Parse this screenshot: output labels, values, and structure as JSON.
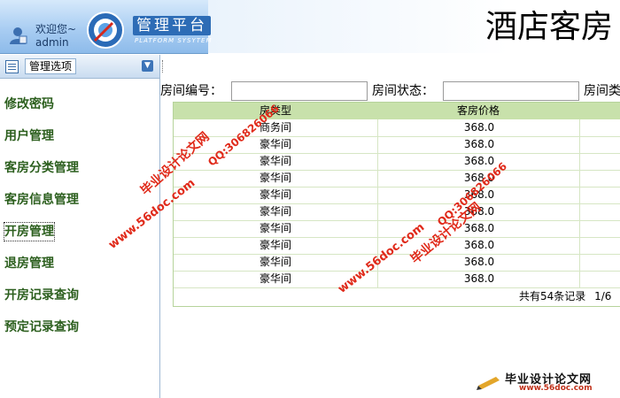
{
  "header": {
    "welcome": "欢迎您~",
    "username": "admin",
    "platform_title": "管理平台",
    "platform_subtitle": "PLATFORM SYSYTEM",
    "system_title": "酒店客房"
  },
  "sidebar": {
    "header_label": "管理选项",
    "items": [
      {
        "label": "修改密码"
      },
      {
        "label": "用户管理"
      },
      {
        "label": "客房分类管理"
      },
      {
        "label": "客房信息管理"
      },
      {
        "label": "开房管理"
      },
      {
        "label": "退房管理"
      },
      {
        "label": "开房记录查询"
      },
      {
        "label": "预定记录查询"
      }
    ]
  },
  "filters": {
    "room_number_label": "房间编号：",
    "room_number_value": "",
    "room_status_label": "房间状态：",
    "room_status_value": "",
    "room_type_label": "房间类"
  },
  "table": {
    "columns": [
      "房类型",
      "客房价格"
    ],
    "rows": [
      [
        "商务间",
        "368.0"
      ],
      [
        "豪华间",
        "368.0"
      ],
      [
        "豪华间",
        "368.0"
      ],
      [
        "豪华间",
        "368.0"
      ],
      [
        "豪华间",
        "368.0"
      ],
      [
        "豪华间",
        "368.0"
      ],
      [
        "豪华间",
        "368.0"
      ],
      [
        "豪华间",
        "368.0"
      ],
      [
        "豪华间",
        "368.0"
      ],
      [
        "豪华间",
        "368.0"
      ]
    ]
  },
  "pager": {
    "total_text": "共有54条记录",
    "page_text": "1/6",
    "first_text": "【"
  },
  "watermarks": {
    "site_name": "毕业设计论文网",
    "url": "www.56doc.com",
    "qq": "QQ:306826066"
  },
  "footer_logo": {
    "name": "毕业设计论文网",
    "url": "www.56doc.com"
  },
  "colors": {
    "menu_text": "#2c5f1e",
    "grid_header": "#c8e1ab",
    "watermark": "#e02a1a",
    "header_band": "#a9cdf2"
  }
}
